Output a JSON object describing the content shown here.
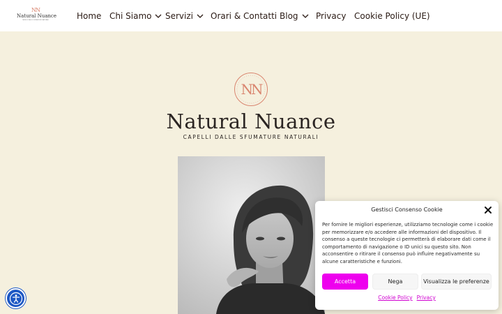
{
  "header": {
    "logo": {
      "monogram": "NN",
      "wordmark": "Natural Nuance",
      "tagline": "CAPELLI DALLE SFUMATURE NATURALI"
    },
    "nav": [
      {
        "label": "Home",
        "dropdown": false
      },
      {
        "label": "Chi Siamo",
        "dropdown": true
      },
      {
        "label": "Servizi",
        "dropdown": true
      },
      {
        "label": "Orari & Contatti",
        "dropdown": false
      },
      {
        "label": "Blog",
        "dropdown": true
      },
      {
        "label": "Privacy",
        "dropdown": false
      },
      {
        "label": "Cookie Policy (UE)",
        "dropdown": false
      }
    ]
  },
  "hero": {
    "monogram": "NN",
    "title": "Natural Nuance",
    "tagline": "CAPELLI DALLE SFUMATURE NATURALI"
  },
  "accessibility": {
    "icon": "accessibility-icon"
  },
  "cookie_banner": {
    "title": "Gestisci Consenso Cookie",
    "close_icon": "close-icon",
    "text": "Per fornire le migliori esperienze, utilizziamo tecnologie come i cookie per memorizzare e/o accedere alle informazioni del dispositivo. Il consenso a queste tecnologie ci permetterà di elaborare dati come il comportamento di navigazione o ID unici su questo sito. Non acconsentire o ritirare il consenso può influire negativamente su alcune caratteristiche e funzioni.",
    "buttons": {
      "accept": "Accetta",
      "deny": "Nega",
      "preferences": "Visualizza le preferenze"
    },
    "links": {
      "cookie_policy": "Cookie Policy",
      "privacy": "Privacy"
    }
  },
  "colors": {
    "background": "#f5f0de",
    "header_bg": "#ffffff",
    "accent_peach": "#d9856f",
    "accept_button": "#ee00ee",
    "link_magenta": "#d000d0",
    "a11y_blue": "#1d58c4"
  }
}
